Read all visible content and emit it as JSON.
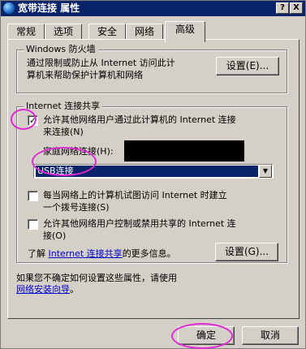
{
  "window": {
    "title": "宽带连接 属性",
    "help_btn": "?",
    "close_btn": "X"
  },
  "tabs": [
    {
      "label": "常规"
    },
    {
      "label": "选项"
    },
    {
      "label": "安全"
    },
    {
      "label": "网络"
    },
    {
      "label": "高级"
    }
  ],
  "firewall": {
    "legend": "Windows 防火墙",
    "desc_line1": "通过限制或防止从 Internet 访问此计",
    "desc_line2": "算机来帮助保护计算机和网络",
    "settings_btn": "设置(E)..."
  },
  "ics": {
    "legend": "Internet 连接共享",
    "allow_line1": "允许其他网络用户通过此计算机的 Internet 连接",
    "allow_line2": "来连接(N)",
    "allow_checked": "✓",
    "home_label": "家庭网络连接(H):",
    "home_value": "USB连接",
    "dropdown_arrow": "▼",
    "dial_line1": "每当网络上的计算机试图访问 Internet 时建立",
    "dial_line2": "一个拨号连接(S)",
    "control_line1": "允许其他网络用户控制或禁用共享的 Internet 连",
    "control_line2": "接(O)",
    "more_prefix": "了解",
    "more_link": "Internet 连接共享",
    "more_suffix": "的更多信息。",
    "settings_btn": "设置(G)..."
  },
  "footer": {
    "line1": "如果您不确定如何设置这些属性，请使用",
    "wizard_link": "网络安装向导",
    "line_end": "。"
  },
  "buttons": {
    "ok": "确定",
    "cancel": "取消"
  },
  "colors": {
    "titlebar": "#0a246a",
    "face": "#d4d0c8",
    "annotation": "#e02ad6",
    "link": "#0000cc"
  }
}
